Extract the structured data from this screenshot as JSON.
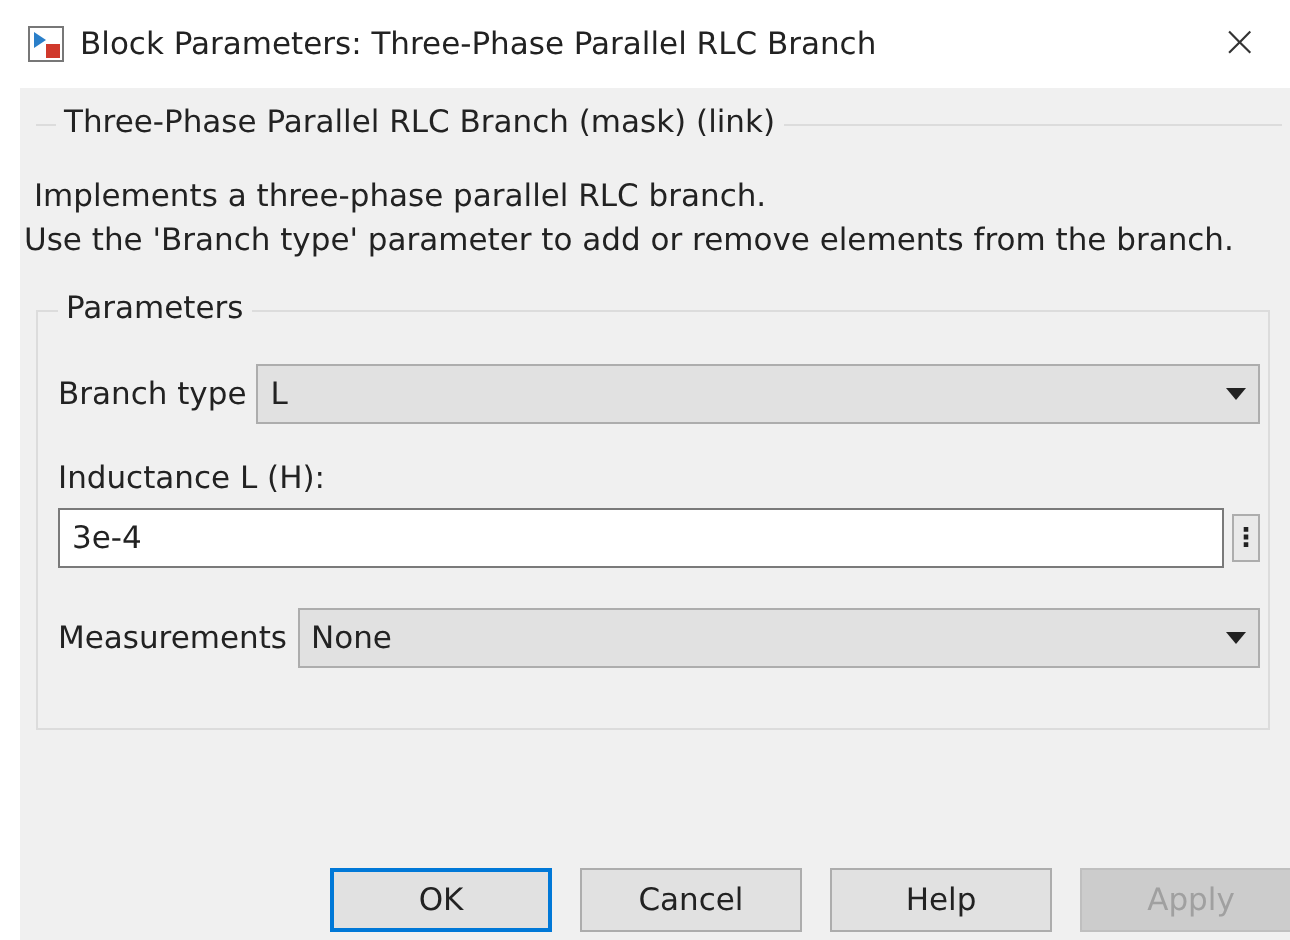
{
  "window": {
    "title": "Block Parameters: Three-Phase Parallel RLC Branch",
    "close": "×"
  },
  "mask_group": {
    "title": "Three-Phase Parallel RLC Branch (mask) (link)",
    "description": [
      " Implements a three-phase parallel RLC branch.",
      "Use the 'Branch type' parameter to add or remove elements from the branch."
    ]
  },
  "parameters": {
    "title": "Parameters",
    "fields": [
      {
        "kind": "dropdown",
        "label": "Branch type",
        "value": "L"
      },
      {
        "kind": "text",
        "label": "Inductance L (H):",
        "value": "3e-4",
        "menu": "⋮"
      },
      {
        "kind": "dropdown",
        "label": "Measurements",
        "value": "None"
      }
    ]
  },
  "buttons": [
    {
      "label": "OK",
      "default": true,
      "disabled": false
    },
    {
      "label": "Cancel",
      "default": false,
      "disabled": false
    },
    {
      "label": "Help",
      "default": false,
      "disabled": false
    },
    {
      "label": "Apply",
      "default": false,
      "disabled": true
    }
  ]
}
